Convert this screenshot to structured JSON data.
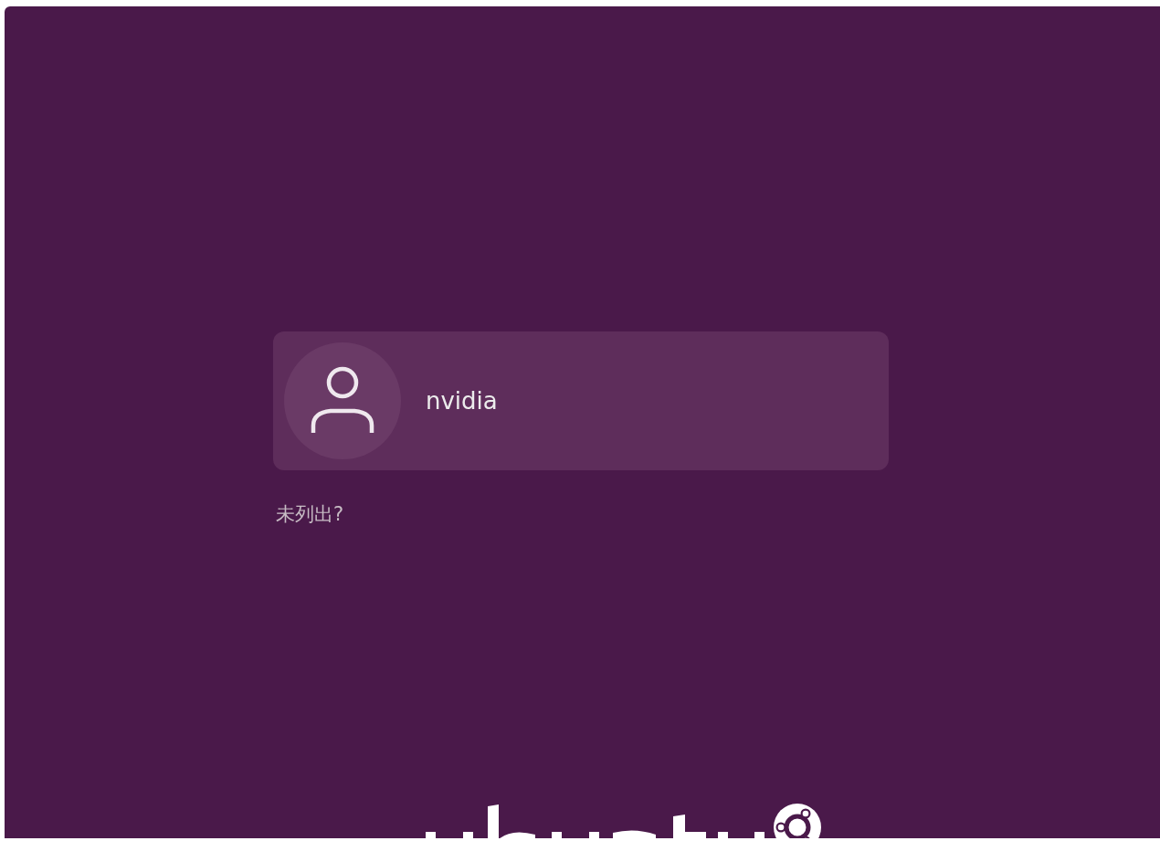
{
  "user_list": [
    {
      "name": "nvidia"
    }
  ],
  "not_listed_link": "未列出?"
}
